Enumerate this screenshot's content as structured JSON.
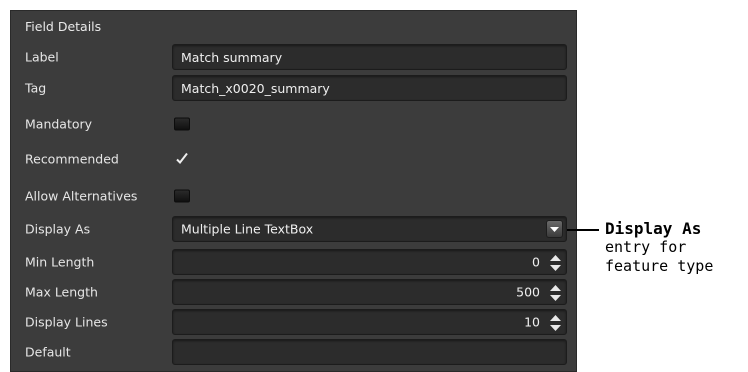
{
  "panel": {
    "title": "Field Details",
    "label": {
      "name": "Label",
      "value": "Match summary"
    },
    "tag": {
      "name": "Tag",
      "value": "Match_x0020_summary"
    },
    "mandatory": {
      "name": "Mandatory",
      "checked": false
    },
    "recommended": {
      "name": "Recommended",
      "checked": true
    },
    "allow_alternatives": {
      "name": "Allow Alternatives",
      "checked": false
    },
    "display_as": {
      "name": "Display As",
      "value": "Multiple Line TextBox"
    },
    "min_length": {
      "name": "Min Length",
      "value": "0"
    },
    "max_length": {
      "name": "Max Length",
      "value": "500"
    },
    "display_lines": {
      "name": "Display Lines",
      "value": "10"
    },
    "default": {
      "name": "Default",
      "value": ""
    }
  },
  "callout": {
    "heading": "Display As",
    "line1": "entry for",
    "line2": "feature type"
  },
  "colors": {
    "panel_bg": "#3c3c3c",
    "field_bg": "#2c2c2c",
    "text": "#e6e6e6"
  },
  "icons": {
    "dropdown": "chevron-down-icon",
    "spinner": "spinner-arrows-icon",
    "check": "checkmark-icon"
  }
}
